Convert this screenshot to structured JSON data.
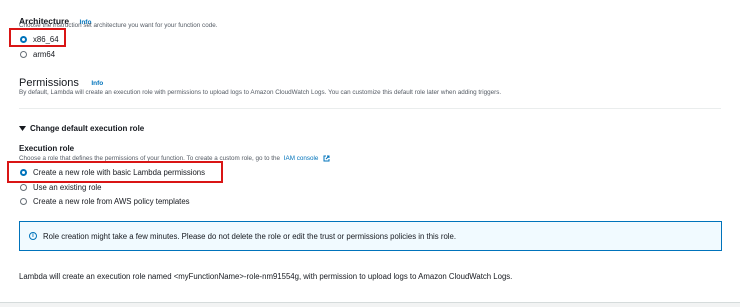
{
  "architecture": {
    "label": "Architecture",
    "info": "Info",
    "description": "Choose the instruction set architecture you want for your function code.",
    "options": [
      {
        "label": "x86_64",
        "selected": true
      },
      {
        "label": "arm64",
        "selected": false
      }
    ]
  },
  "permissions": {
    "heading": "Permissions",
    "info": "Info",
    "description": "By default, Lambda will create an execution role with permissions to upload logs to Amazon CloudWatch Logs. You can customize this default role later when adding triggers.",
    "toggle_label": "Change default execution role",
    "execution_role": {
      "label": "Execution role",
      "description_prefix": "Choose a role that defines the permissions of your function. To create a custom role, go to the",
      "iam_link": "IAM console",
      "options": [
        {
          "label": "Create a new role with basic Lambda permissions",
          "selected": true
        },
        {
          "label": "Use an existing role",
          "selected": false
        },
        {
          "label": "Create a new role from AWS policy templates",
          "selected": false
        }
      ]
    },
    "alert_text": "Role creation might take a few minutes. Please do not delete the role or edit the trust or permissions policies in this role.",
    "footer_text": "Lambda will create an execution role named <myFunctionName>-role-nm91554g, with permission to upload logs to Amazon CloudWatch Logs."
  },
  "colors": {
    "accent": "#0073bb",
    "highlight": "#d91515",
    "alert_bg": "#f1faff"
  }
}
